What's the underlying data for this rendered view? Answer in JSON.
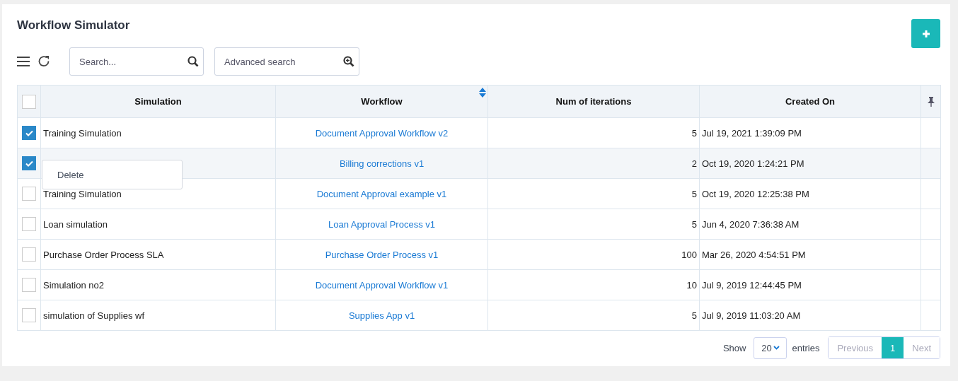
{
  "title": "Workflow Simulator",
  "toolbar": {
    "search": {
      "placeholder": "Search..."
    },
    "advanced_search": {
      "placeholder": "Advanced search"
    }
  },
  "table": {
    "columns": [
      {
        "label": "Simulation",
        "sortable": false
      },
      {
        "label": "Workflow",
        "sortable": true
      },
      {
        "label": "Num of iterations",
        "sortable": false
      },
      {
        "label": "Created On",
        "sortable": false
      }
    ],
    "all_checked": false,
    "rows": [
      {
        "checked": true,
        "simulation": "Training Simulation",
        "workflow": "Document Approval Workflow v2",
        "iterations": "5",
        "created": "Jul 19, 2021 1:39:09 PM"
      },
      {
        "checked": true,
        "workflow": "Billing corrections v1",
        "iterations": "2",
        "created": "Oct 19, 2020 1:24:21 PM",
        "context_menu": [
          "Delete"
        ]
      },
      {
        "checked": false,
        "simulation": "Training Simulation",
        "workflow": "Document Approval example v1",
        "iterations": "5",
        "created": "Oct 19, 2020 12:25:38 PM"
      },
      {
        "checked": false,
        "simulation": "Loan simulation",
        "workflow": "Loan Approval Process v1",
        "iterations": "5",
        "created": "Jun 4, 2020 7:36:38 AM"
      },
      {
        "checked": false,
        "simulation": "Purchase Order Process SLA",
        "workflow": "Purchase Order Process v1",
        "iterations": "100",
        "created": "Mar 26, 2020 4:54:51 PM"
      },
      {
        "checked": false,
        "simulation": "Simulation no2",
        "workflow": "Document Approval Workflow v1",
        "iterations": "10",
        "created": "Jul 9, 2019 12:44:45 PM"
      },
      {
        "checked": false,
        "simulation": "simulation of Supplies wf",
        "workflow": "Supplies App v1",
        "iterations": "5",
        "created": "Jul 9, 2019 11:03:20 AM"
      }
    ]
  },
  "footer": {
    "show_label": "Show",
    "page_size": "20",
    "entries_label": "entries",
    "previous": "Previous",
    "pages": [
      {
        "label": "1",
        "selected": true
      }
    ],
    "next": "Next"
  }
}
